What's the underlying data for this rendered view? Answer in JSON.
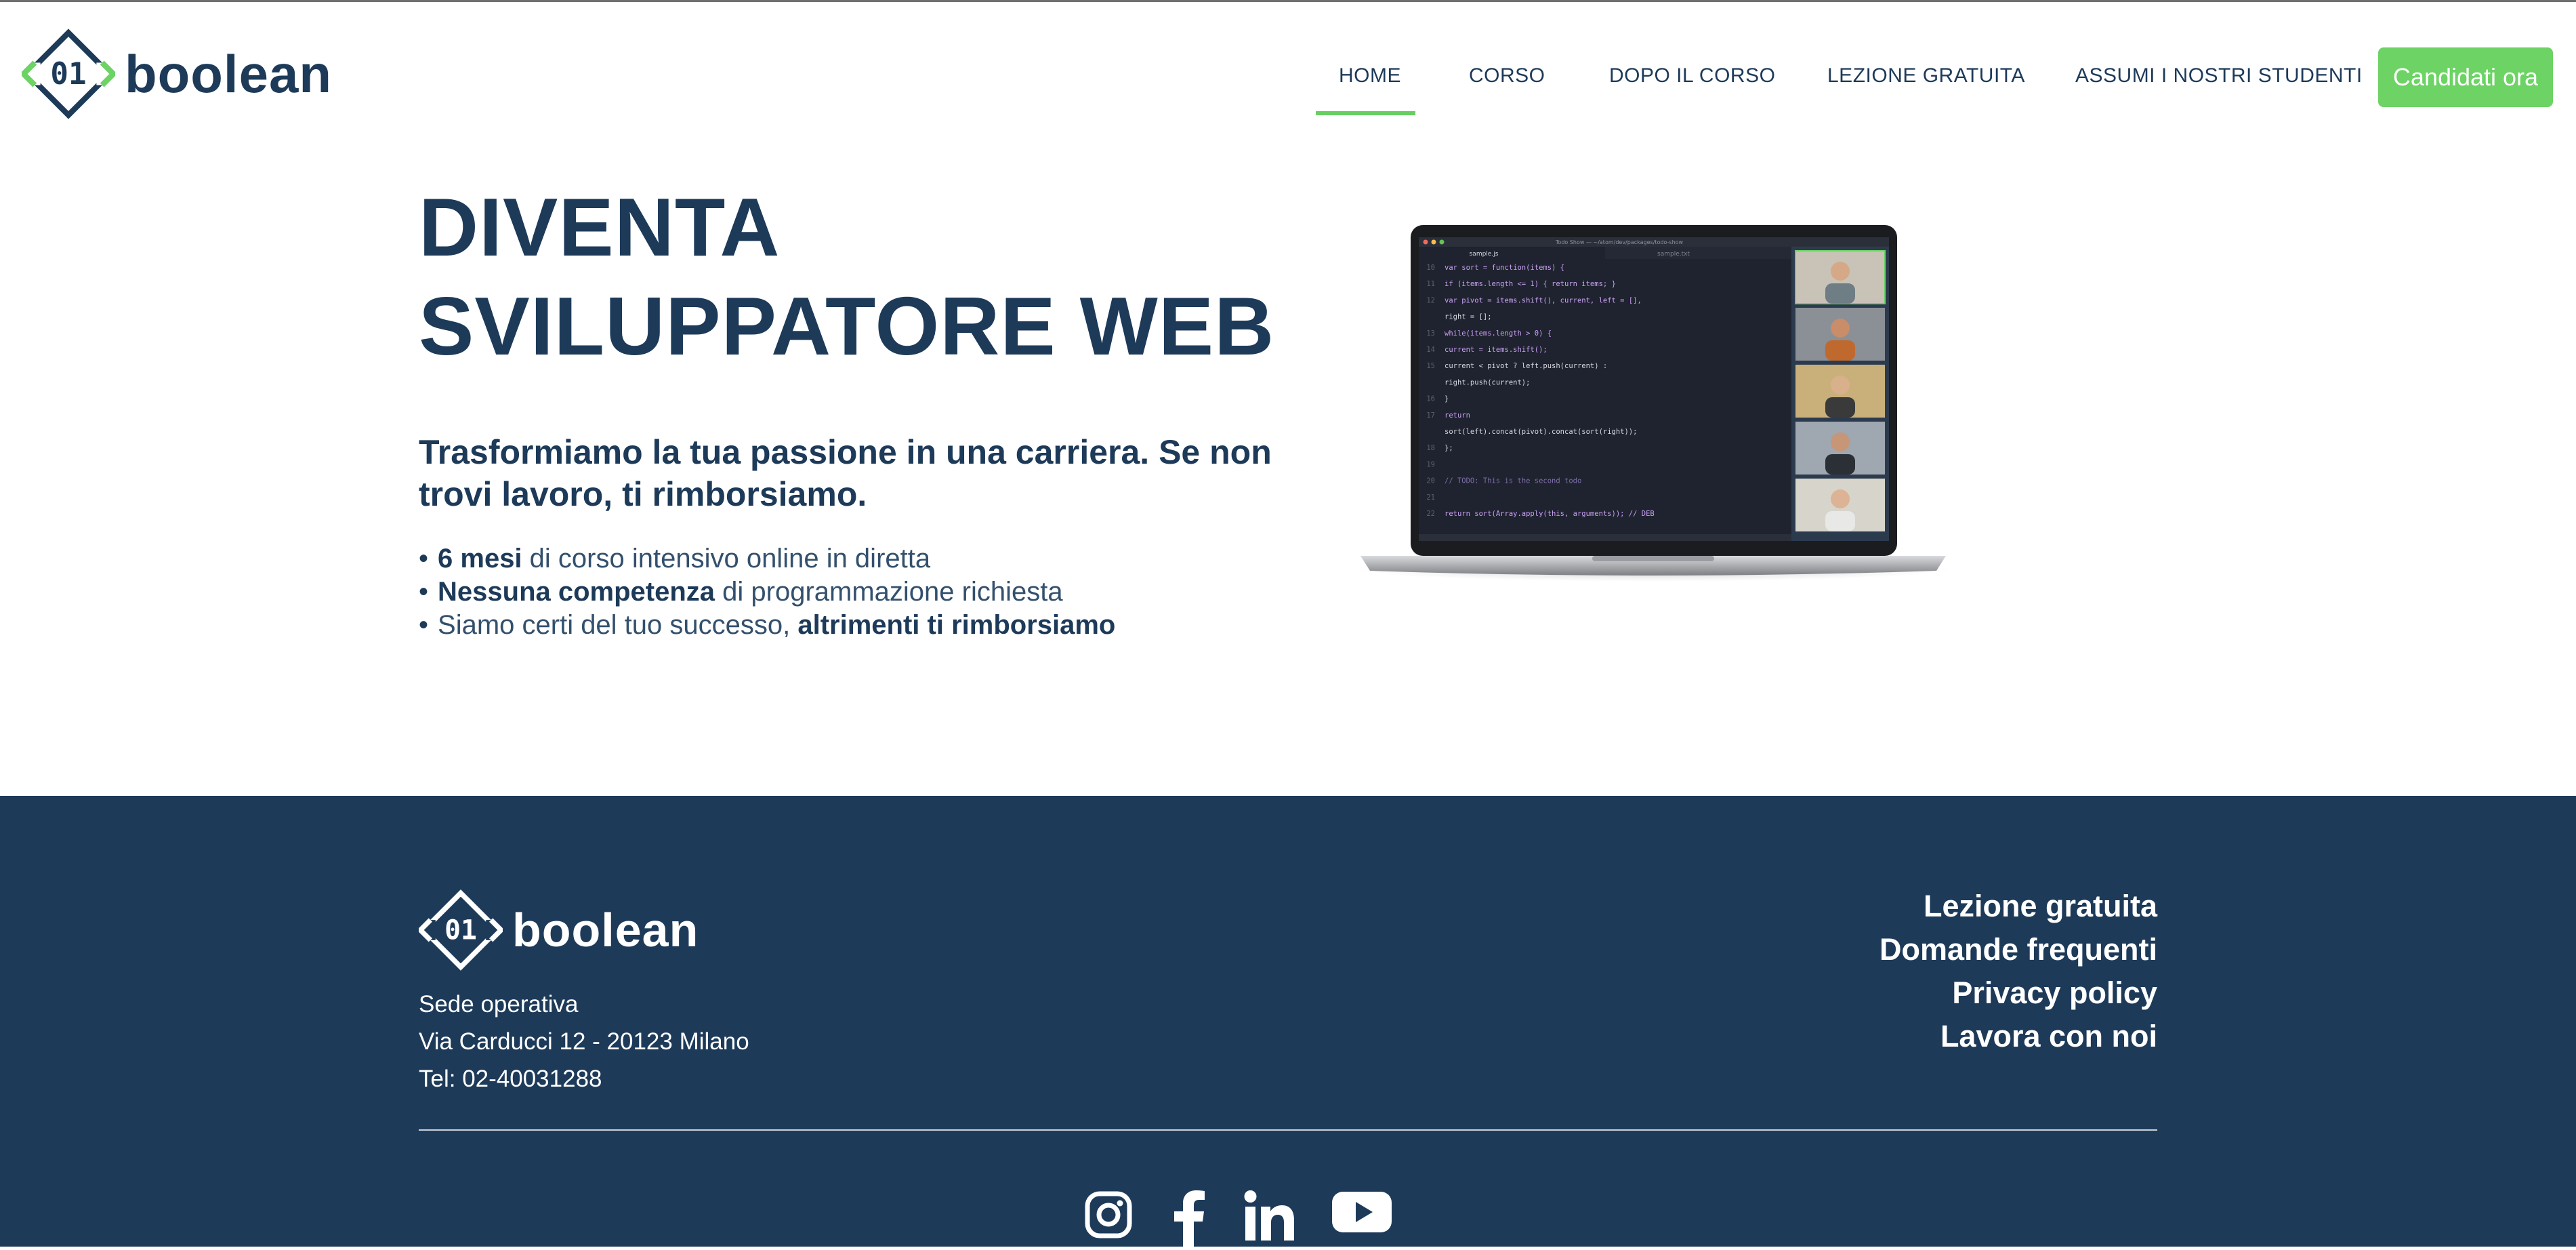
{
  "brand": {
    "name": "boolean",
    "mark": "01",
    "accent": "#6cd364",
    "navy": "#1d3a59"
  },
  "nav": {
    "items": [
      {
        "label": "HOME",
        "active": true
      },
      {
        "label": "CORSO"
      },
      {
        "label": "DOPO IL CORSO"
      },
      {
        "label": "LEZIONE GRATUITA"
      },
      {
        "label": "ASSUMI I NOSTRI STUDENTI"
      }
    ],
    "cta": "Candidati ora"
  },
  "hero": {
    "title_line1": "DIVENTA",
    "title_line2": "SVILUPPATORE WEB",
    "subtitle": "Trasformiamo la tua passione in una carriera. Se non trovi lavoro, ti rimborsiamo.",
    "bullets": [
      {
        "bold": "6 mesi",
        "text": " di corso intensivo online in diretta"
      },
      {
        "bold": "Nessuna competenza",
        "text": " di programmazione richiesta"
      },
      {
        "pre": "Siamo certi del tuo successo, ",
        "bold": "altrimenti ti rimborsiamo"
      }
    ]
  },
  "laptop": {
    "window_title": "Todo Show — ~/atom/dev/packages/todo-show",
    "tabs": [
      "sample.js",
      "sample.txt"
    ],
    "code": [
      {
        "n": "10",
        "t": "var sort = function(items) {"
      },
      {
        "n": "11",
        "t": "  if (items.length <= 1) { return items; }"
      },
      {
        "n": "12",
        "t": "  var pivot = items.shift(), current, left = [],"
      },
      {
        "n": "",
        "t": "  right = [];"
      },
      {
        "n": "13",
        "t": "  while(items.length > 0) {"
      },
      {
        "n": "14",
        "t": "    current = items.shift();"
      },
      {
        "n": "15",
        "t": "    current < pivot ? left.push(current) :"
      },
      {
        "n": "",
        "t": "    right.push(current);"
      },
      {
        "n": "16",
        "t": "  }"
      },
      {
        "n": "17",
        "t": "  return"
      },
      {
        "n": "",
        "t": "  sort(left).concat(pivot).concat(sort(right));"
      },
      {
        "n": "18",
        "t": "};"
      },
      {
        "n": "19",
        "t": ""
      },
      {
        "n": "20",
        "t": "// TODO: This is the second todo"
      },
      {
        "n": "21",
        "t": ""
      },
      {
        "n": "22",
        "t": "return sort(Array.apply(this, arguments));  // DEB"
      }
    ]
  },
  "footer": {
    "brand": "boolean",
    "address_label": "Sede operativa",
    "address": "Via Carducci 12 - 20123 Milano",
    "phone": "Tel: 02-40031288",
    "links": [
      "Lezione gratuita",
      "Domande frequenti",
      "Privacy policy",
      "Lavora con noi"
    ],
    "socials": [
      "instagram-icon",
      "facebook-icon",
      "linkedin-icon",
      "youtube-icon"
    ]
  }
}
